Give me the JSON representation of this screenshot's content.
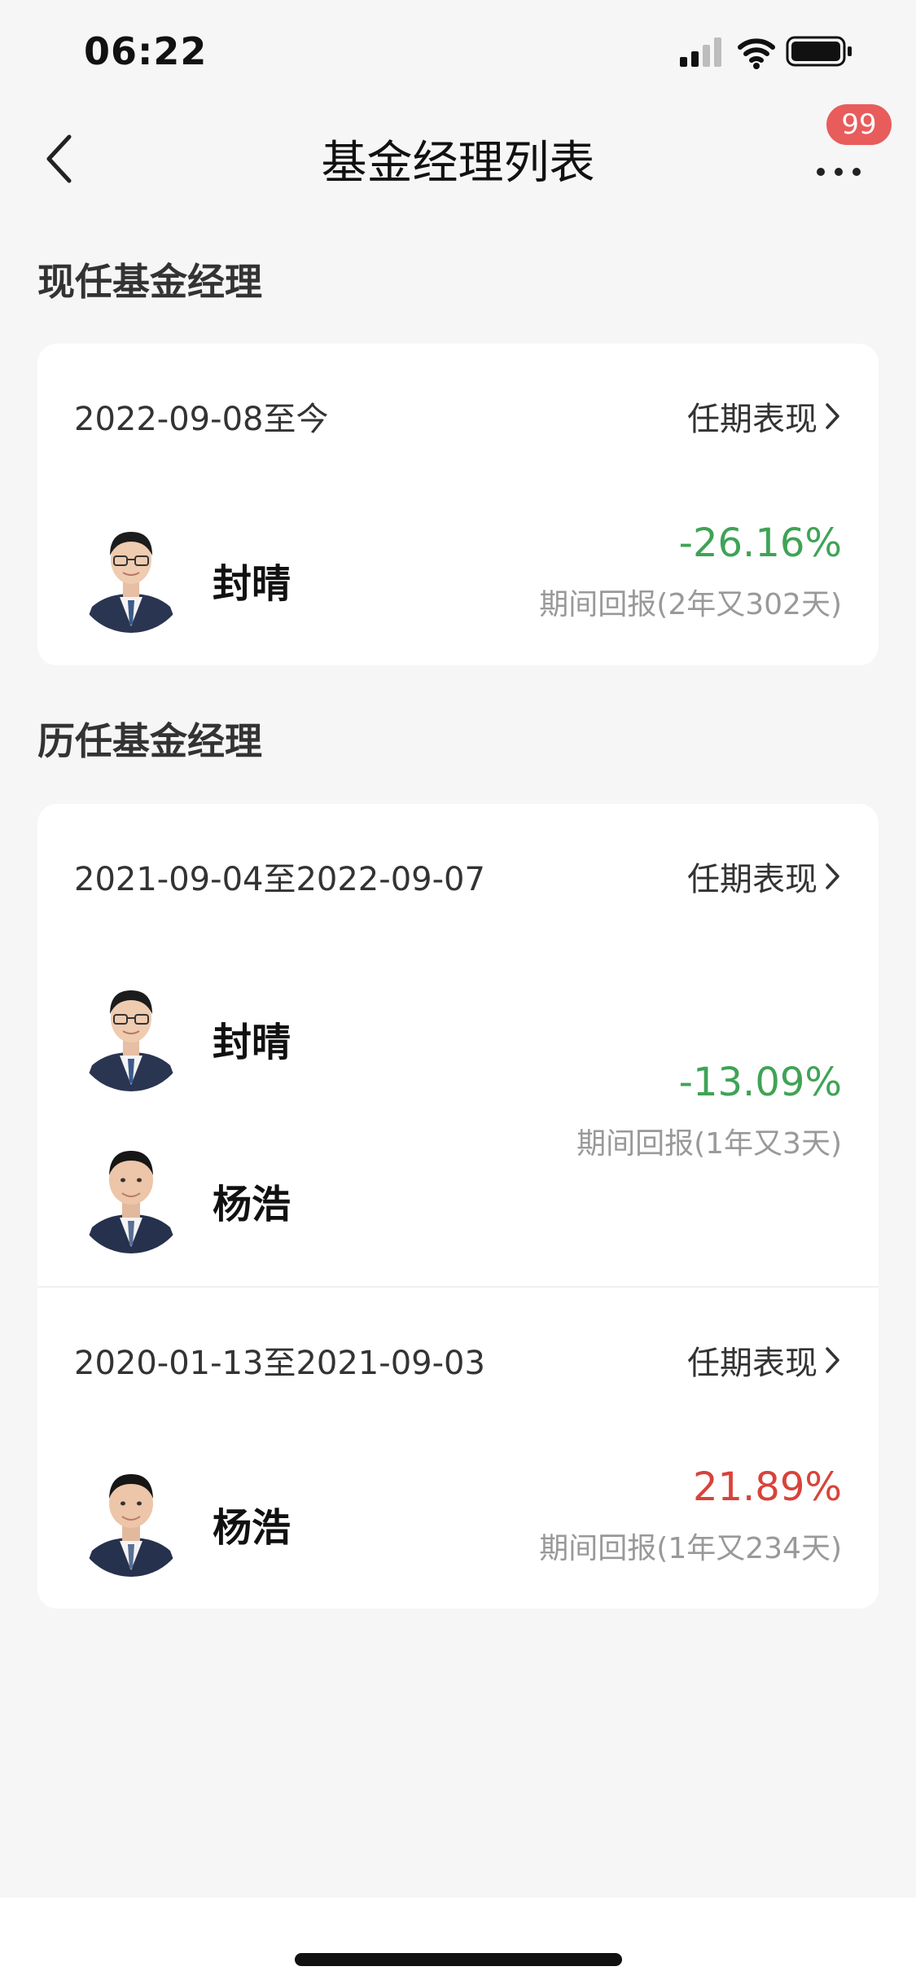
{
  "status_bar": {
    "time": "06:22"
  },
  "nav": {
    "title": "基金经理列表",
    "badge": "99"
  },
  "current_section": {
    "title": "现任基金经理",
    "periods": [
      {
        "date_range": "2022-09-08至今",
        "link": "任期表现",
        "managers": [
          "封晴"
        ],
        "return_value": "-26.16%",
        "return_label": "期间回报(2年又302天)"
      }
    ]
  },
  "history_section": {
    "title": "历任基金经理",
    "periods": [
      {
        "date_range": "2021-09-04至2022-09-07",
        "link": "任期表现",
        "managers": [
          "封晴",
          "杨浩"
        ],
        "return_value": "-13.09%",
        "return_label": "期间回报(1年又3天)"
      },
      {
        "date_range": "2020-01-13至2021-09-03",
        "link": "任期表现",
        "managers": [
          "杨浩"
        ],
        "return_value": "21.89%",
        "return_label": "期间回报(1年又234天)"
      }
    ]
  },
  "colors": {
    "negative_return": "#3fa356",
    "positive_return": "#d8433a",
    "badge": "#e85c5c"
  }
}
